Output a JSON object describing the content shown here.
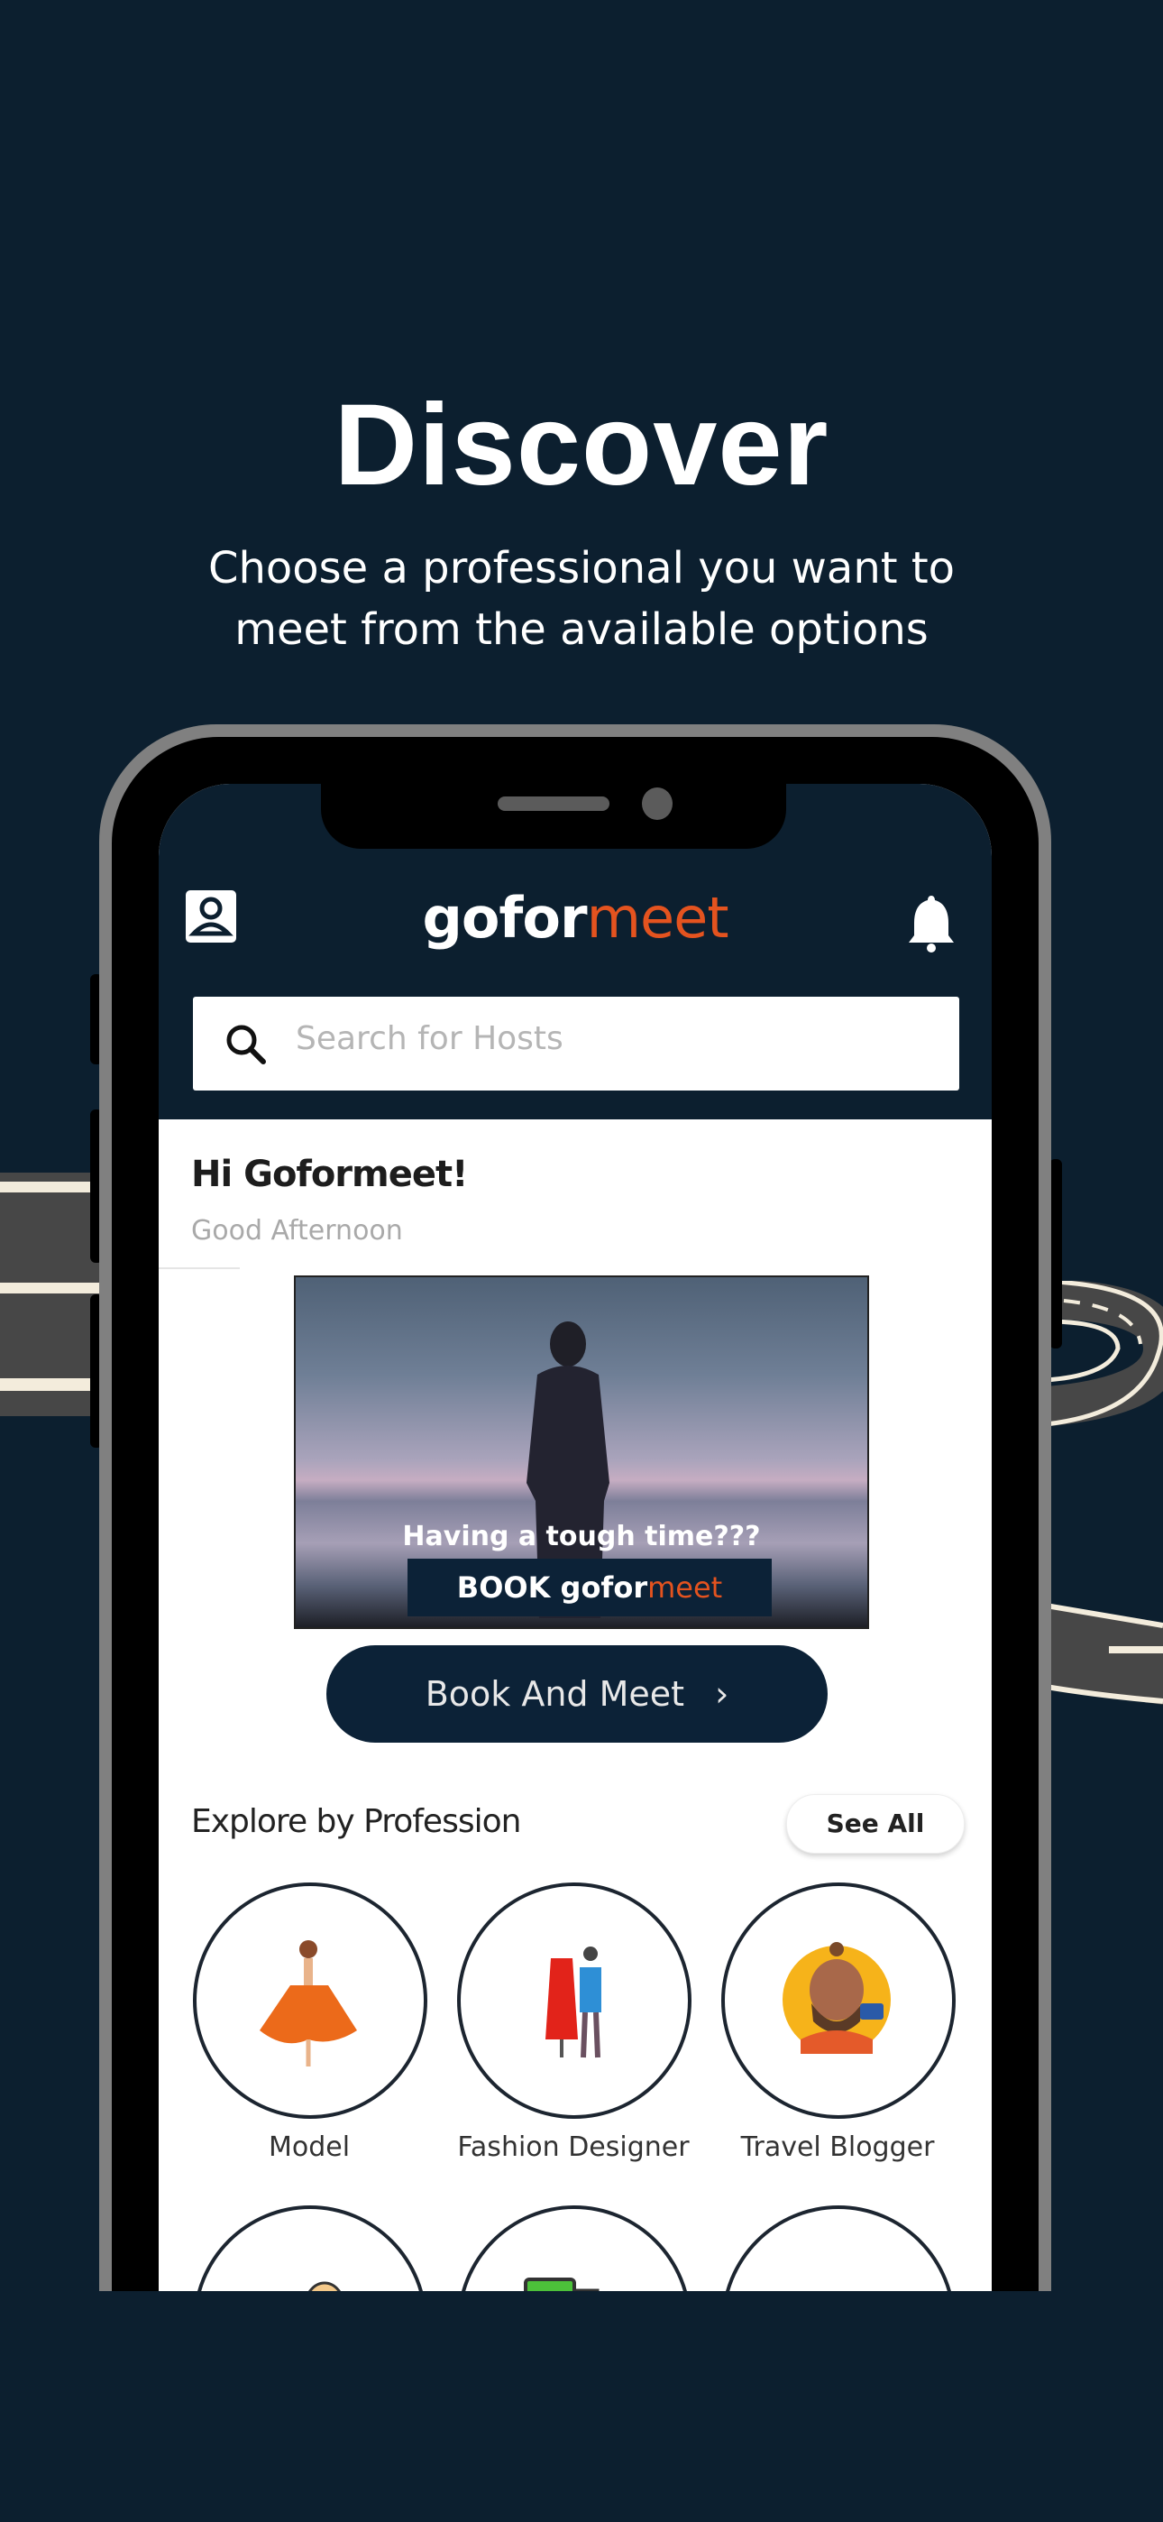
{
  "hero": {
    "title": "Discover",
    "subtitle_line1": "Choose a professional you want to",
    "subtitle_line2": "meet from the available options"
  },
  "app": {
    "logo_part1": "gofor",
    "logo_part2": "meet",
    "brand_color": "#e4531f",
    "header_bg": "#0c1f2f",
    "search": {
      "placeholder": "Search for Hosts",
      "value": ""
    },
    "greeting": {
      "title": "Hi Goformeet!",
      "subtitle": "Good Afternoon"
    },
    "banner": {
      "tagline": "Having a  tough time???",
      "cta_prefix": "BOOK gofor",
      "cta_suffix": "meet"
    },
    "book_button": {
      "label": "Book And Meet",
      "chevron": "›"
    },
    "explore": {
      "title": "Explore by Profession",
      "see_all": "See All",
      "professions": [
        {
          "label": "Model",
          "icon": "model-illustration"
        },
        {
          "label": "Fashion Designer",
          "icon": "fashion-designer-illustration"
        },
        {
          "label": "Travel Blogger",
          "icon": "travel-blogger-illustration"
        },
        {
          "label": "",
          "icon": "person-illustration"
        },
        {
          "label": "",
          "icon": "camera-illustration"
        },
        {
          "label": "",
          "icon": "hardhat-illustration"
        }
      ]
    }
  }
}
